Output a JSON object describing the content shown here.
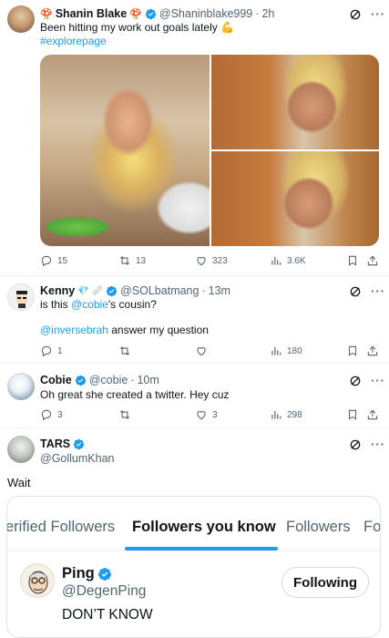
{
  "tweet1": {
    "name": "Shanin Blake",
    "handle": "@Shaninblake999",
    "time": "2h",
    "text": "Been hitting my work out goals lately",
    "emoji": "💪",
    "hashtag": "#explorepage",
    "replies": "15",
    "retweets": "13",
    "likes": "323",
    "views": "3.6K"
  },
  "reply1": {
    "name": "Kenny",
    "handle": "@SOLbatmang",
    "time": "13m",
    "text_pre": "is this ",
    "mention": "@cobie",
    "text_post": "'s cousin?",
    "mention2": "@inversebrah",
    "text2": " answer my question",
    "replies": "1",
    "retweets": "",
    "likes": "",
    "views": "180"
  },
  "reply2": {
    "name": "Cobie",
    "handle": "@cobie",
    "time": "10m",
    "text": "Oh great she created a twitter. Hey cuz",
    "replies": "3",
    "retweets": "",
    "likes": "3",
    "views": "298"
  },
  "reply3": {
    "name": "TARS",
    "handle": "@GollumKhan"
  },
  "caption": "Wait",
  "card": {
    "tabs": [
      "erified Followers",
      "Followers you know",
      "Followers",
      "Fo"
    ],
    "active_tab": "Followers you know",
    "user_name": "Ping",
    "user_handle": "@DegenPing",
    "user_bio": "DON’T KNOW",
    "follow_label": "Following"
  },
  "colors": {
    "accent": "#1d9bf0",
    "text": "#0f1419",
    "muted": "#536471"
  }
}
